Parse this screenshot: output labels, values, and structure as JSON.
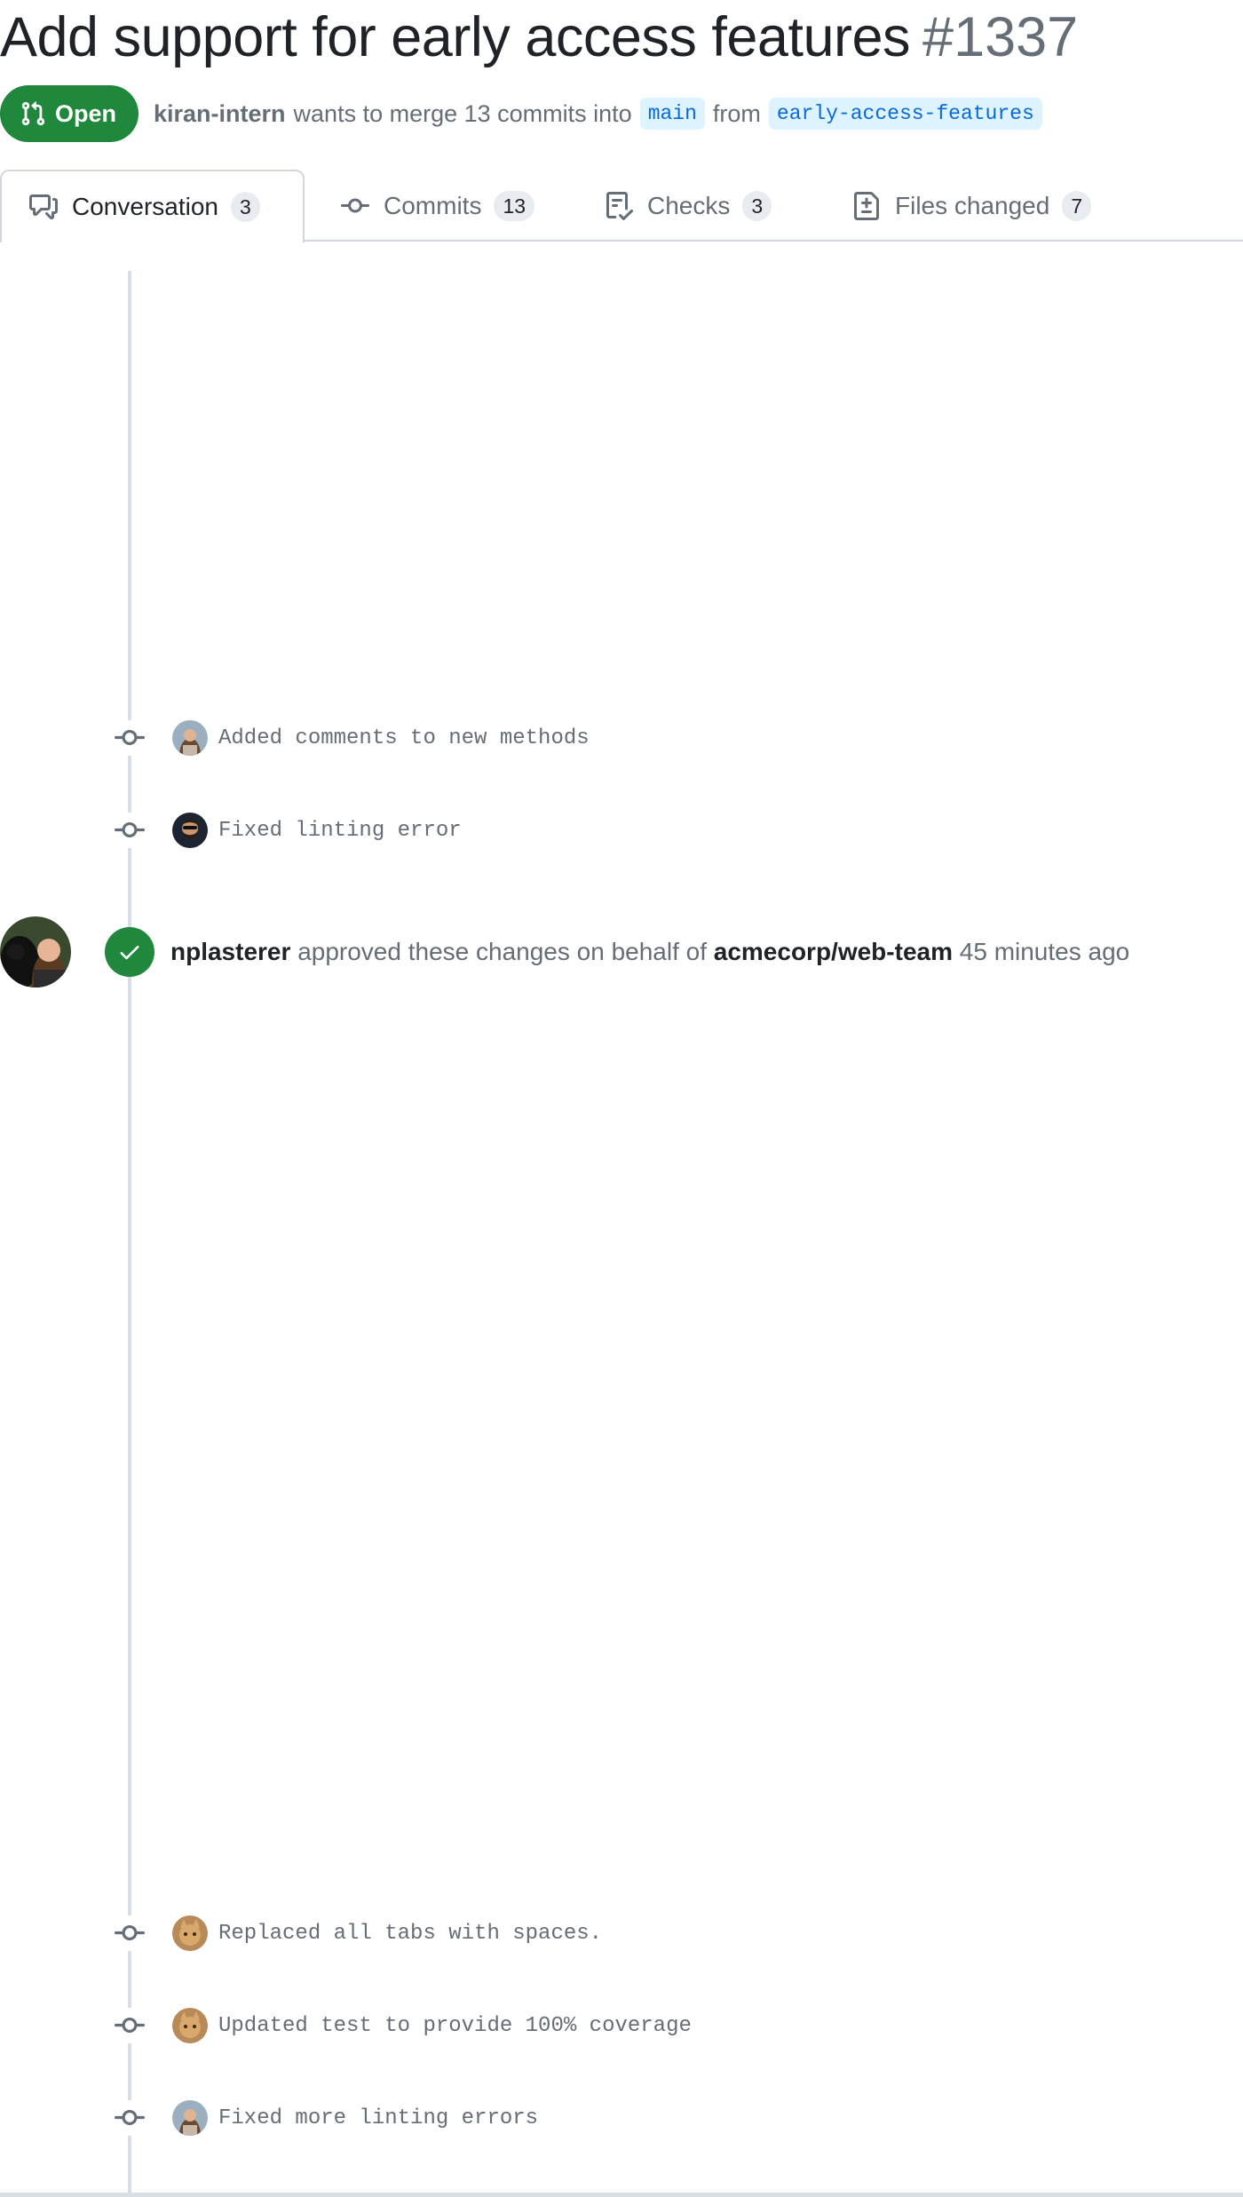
{
  "pull_request": {
    "title": "Add support for early access features",
    "number": "#1337",
    "state": "Open",
    "author": "kiran-intern",
    "merge_text_1": "wants to merge 13 commits into",
    "base_branch": "main",
    "merge_text_2": "from",
    "head_branch": "early-access-features"
  },
  "tabs": [
    {
      "label": "Conversation",
      "count": "3",
      "icon": "comment-discussion-icon",
      "selected": true
    },
    {
      "label": "Commits",
      "count": "13",
      "icon": "git-commit-icon",
      "selected": false
    },
    {
      "label": "Checks",
      "count": "3",
      "icon": "checklist-icon",
      "selected": false
    },
    {
      "label": "Files changed",
      "count": "7",
      "icon": "file-diff-icon",
      "selected": false
    }
  ],
  "timeline": {
    "commits_before": [
      {
        "message": "Added comments to new methods",
        "avatar": "woman-avatar"
      },
      {
        "message": "Fixed linting error",
        "avatar": "bearded-man-avatar"
      }
    ],
    "review": {
      "reviewer": "nplasterer",
      "action_text": "approved these changes on behalf of",
      "team": "acmecorp/web-team",
      "time": "45 minutes ago"
    },
    "commits_after": [
      {
        "message": "Replaced all tabs with spaces.",
        "avatar": "cat-avatar"
      },
      {
        "message": "Updated test to provide 100% coverage",
        "avatar": "cat-avatar"
      },
      {
        "message": "Fixed more linting errors",
        "avatar": "woman-avatar"
      }
    ]
  },
  "colors": {
    "open_green": "#1f883d",
    "muted_text": "#656d76",
    "branch_blue": "#0969da",
    "branch_bg": "#ddf4ff",
    "border": "#d0d7de"
  }
}
